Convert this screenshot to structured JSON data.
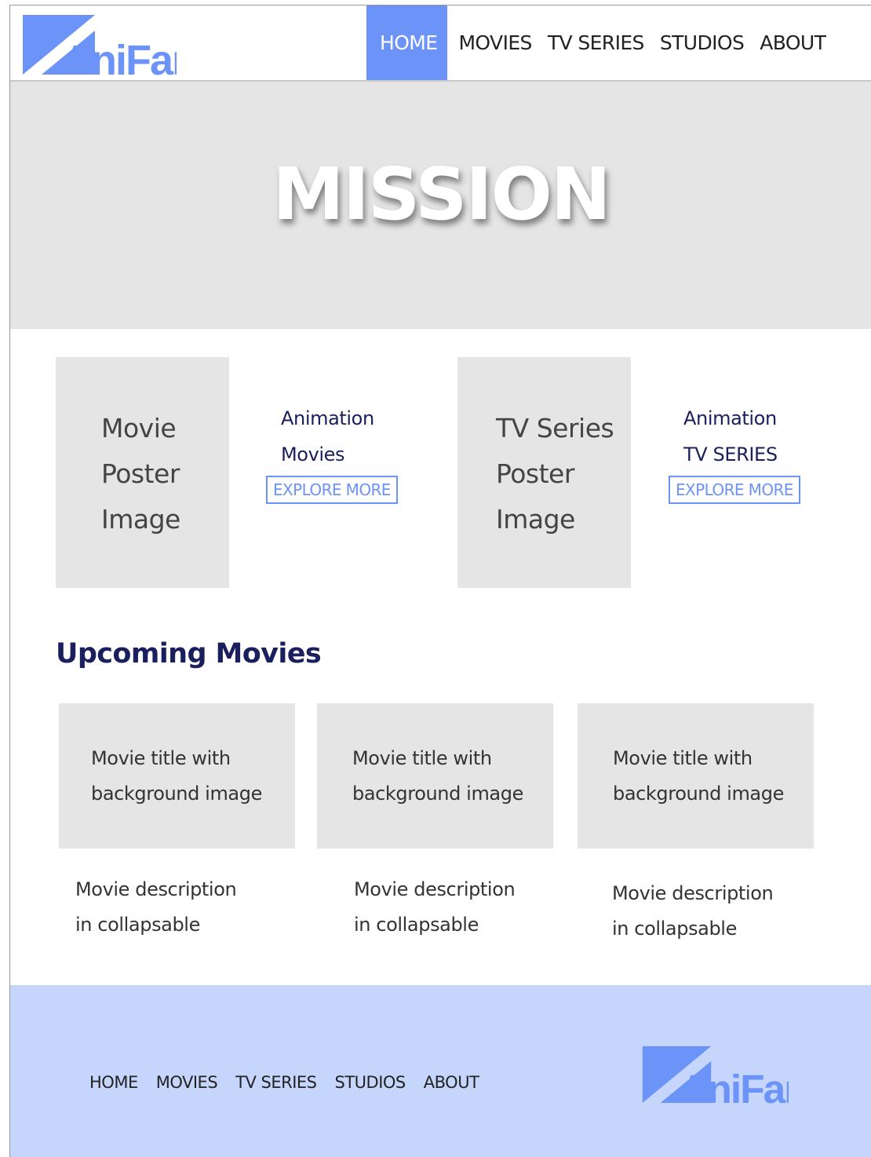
{
  "brand": {
    "name": "AniFan",
    "logo_color": "#6c93f7"
  },
  "header": {
    "nav": [
      {
        "label": "HOME",
        "active": true
      },
      {
        "label": "MOVIES"
      },
      {
        "label": "TV SERIES"
      },
      {
        "label": "STUDIOS"
      },
      {
        "label": "ABOUT"
      }
    ]
  },
  "hero": {
    "title": "MISSION"
  },
  "features": [
    {
      "poster_lines": [
        "Movie",
        "Poster",
        "Image"
      ],
      "label_lines": [
        "Animation",
        "Movies"
      ],
      "button": "EXPLORE MORE"
    },
    {
      "poster_lines": [
        "TV Series",
        "Poster",
        "Image"
      ],
      "label_lines": [
        "Animation",
        "TV SERIES"
      ],
      "button": "EXPLORE MORE"
    }
  ],
  "upcoming": {
    "title": "Upcoming Movies",
    "movies": [
      {
        "title_lines": [
          "Movie title with",
          "background image"
        ],
        "desc_lines": [
          "Movie description",
          "in collapsable"
        ]
      },
      {
        "title_lines": [
          "Movie title with",
          "background image"
        ],
        "desc_lines": [
          "Movie description",
          "in collapsable"
        ]
      },
      {
        "title_lines": [
          "Movie title with",
          "background image"
        ],
        "desc_lines": [
          "Movie description",
          "in collapsable"
        ]
      }
    ]
  },
  "footer": {
    "nav": [
      "HOME",
      "MOVIES",
      "TV SERIES",
      "STUDIOS",
      "ABOUT"
    ]
  },
  "colors": {
    "accent": "#6c93f7",
    "placeholder_gray": "#e5e5e5",
    "footer_bg": "#c5d5fc",
    "heading_navy": "#1a1f5e"
  }
}
